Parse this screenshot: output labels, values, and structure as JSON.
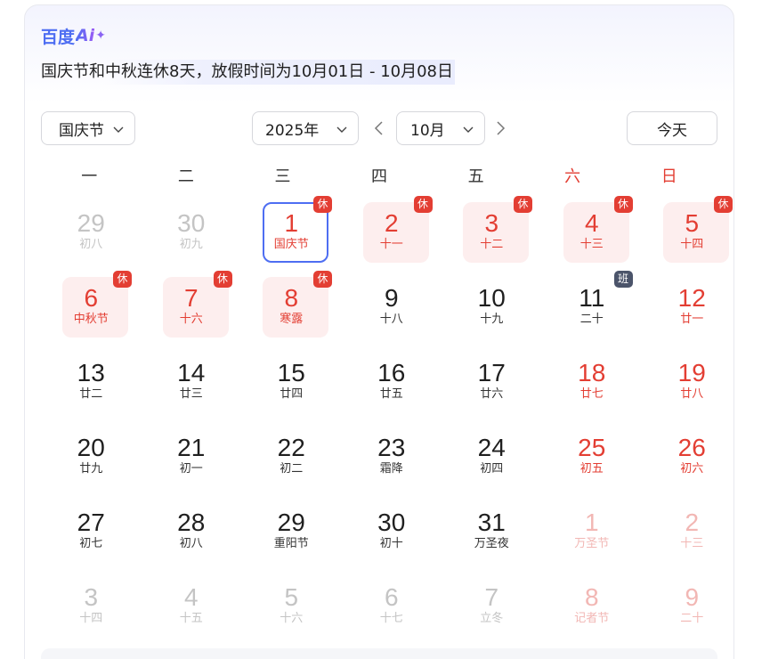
{
  "brand": {
    "text": "百度",
    "ai": "Ai",
    "sparkle": "✦"
  },
  "summary": "国庆节和中秋连休8天，放假时间为10月01日 - 10月08日",
  "controls": {
    "holiday": "国庆节",
    "year": "2025年",
    "month": "10月",
    "today": "今天"
  },
  "colors": {
    "accent": "#4e6ef2",
    "holiday_red": "#e33e33",
    "work_badge": "#4b546a",
    "holiday_bg": "#fdeeee"
  },
  "weekdays": [
    "一",
    "二",
    "三",
    "四",
    "五",
    "六",
    "日"
  ],
  "days": [
    {
      "day": "29",
      "lunar": "初八",
      "state": "other"
    },
    {
      "day": "30",
      "lunar": "初九",
      "state": "other"
    },
    {
      "day": "1",
      "lunar": "国庆节",
      "state": "today",
      "badge": "休"
    },
    {
      "day": "2",
      "lunar": "十一",
      "state": "holiday",
      "badge": "休"
    },
    {
      "day": "3",
      "lunar": "十二",
      "state": "holiday",
      "badge": "休"
    },
    {
      "day": "4",
      "lunar": "十三",
      "state": "holiday",
      "badge": "休"
    },
    {
      "day": "5",
      "lunar": "十四",
      "state": "holiday",
      "badge": "休"
    },
    {
      "day": "6",
      "lunar": "中秋节",
      "state": "holiday",
      "badge": "休"
    },
    {
      "day": "7",
      "lunar": "十六",
      "state": "holiday",
      "badge": "休"
    },
    {
      "day": "8",
      "lunar": "寒露",
      "state": "holiday",
      "badge": "休"
    },
    {
      "day": "9",
      "lunar": "十八",
      "state": "normal"
    },
    {
      "day": "10",
      "lunar": "十九",
      "state": "normal"
    },
    {
      "day": "11",
      "lunar": "二十",
      "state": "normal",
      "badge": "班",
      "badge_type": "work"
    },
    {
      "day": "12",
      "lunar": "廿一",
      "state": "weekend"
    },
    {
      "day": "13",
      "lunar": "廿二",
      "state": "normal"
    },
    {
      "day": "14",
      "lunar": "廿三",
      "state": "normal"
    },
    {
      "day": "15",
      "lunar": "廿四",
      "state": "normal"
    },
    {
      "day": "16",
      "lunar": "廿五",
      "state": "normal"
    },
    {
      "day": "17",
      "lunar": "廿六",
      "state": "normal"
    },
    {
      "day": "18",
      "lunar": "廿七",
      "state": "weekend"
    },
    {
      "day": "19",
      "lunar": "廿八",
      "state": "weekend"
    },
    {
      "day": "20",
      "lunar": "廿九",
      "state": "normal"
    },
    {
      "day": "21",
      "lunar": "初一",
      "state": "normal"
    },
    {
      "day": "22",
      "lunar": "初二",
      "state": "normal"
    },
    {
      "day": "23",
      "lunar": "霜降",
      "state": "normal"
    },
    {
      "day": "24",
      "lunar": "初四",
      "state": "normal"
    },
    {
      "day": "25",
      "lunar": "初五",
      "state": "weekend"
    },
    {
      "day": "26",
      "lunar": "初六",
      "state": "weekend"
    },
    {
      "day": "27",
      "lunar": "初七",
      "state": "normal"
    },
    {
      "day": "28",
      "lunar": "初八",
      "state": "normal"
    },
    {
      "day": "29",
      "lunar": "重阳节",
      "state": "normal"
    },
    {
      "day": "30",
      "lunar": "初十",
      "state": "normal"
    },
    {
      "day": "31",
      "lunar": "万圣夜",
      "state": "normal"
    },
    {
      "day": "1",
      "lunar": "万圣节",
      "state": "other-weekend"
    },
    {
      "day": "2",
      "lunar": "十三",
      "state": "other-weekend"
    },
    {
      "day": "3",
      "lunar": "十四",
      "state": "other"
    },
    {
      "day": "4",
      "lunar": "十五",
      "state": "other"
    },
    {
      "day": "5",
      "lunar": "十六",
      "state": "other"
    },
    {
      "day": "6",
      "lunar": "十七",
      "state": "other"
    },
    {
      "day": "7",
      "lunar": "立冬",
      "state": "other"
    },
    {
      "day": "8",
      "lunar": "记者节",
      "state": "other-weekend"
    },
    {
      "day": "9",
      "lunar": "二十",
      "state": "other-weekend"
    }
  ]
}
